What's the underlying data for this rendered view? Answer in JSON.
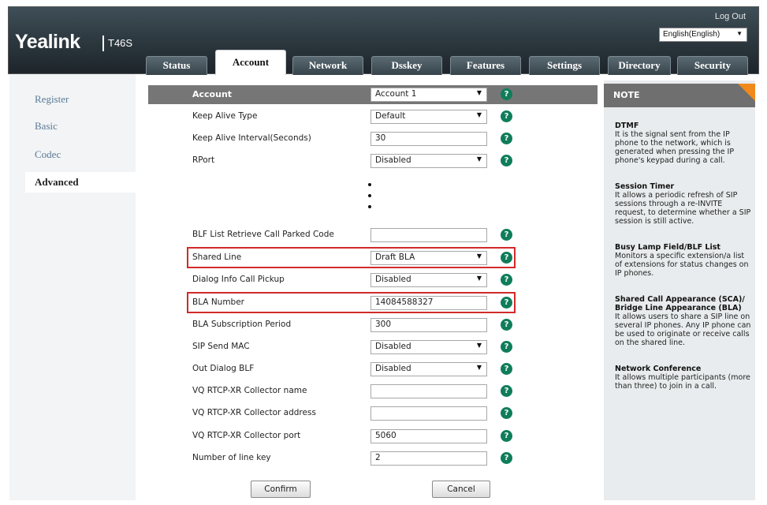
{
  "header": {
    "logo": "Yealink",
    "model": "T46S",
    "logout": "Log Out",
    "language": "English(English)"
  },
  "tabs": [
    "Status",
    "Account",
    "Network",
    "Dsskey",
    "Features",
    "Settings",
    "Directory",
    "Security"
  ],
  "active_tab": "Account",
  "sidebar": {
    "items": [
      "Register",
      "Basic",
      "Codec",
      "Advanced"
    ],
    "active": "Advanced"
  },
  "form": {
    "account_label": "Account",
    "account_value": "Account 1",
    "rows": [
      {
        "label": "Keep Alive Type",
        "value": "Default",
        "type": "select"
      },
      {
        "label": "Keep Alive Interval(Seconds)",
        "value": "30",
        "type": "text"
      },
      {
        "label": "RPort",
        "value": "Disabled",
        "type": "select"
      },
      {
        "label": "BLF List Retrieve Call Parked Code",
        "value": "",
        "type": "text"
      },
      {
        "label": "Shared Line",
        "value": "Draft BLA",
        "type": "select"
      },
      {
        "label": "Dialog Info Call Pickup",
        "value": "Disabled",
        "type": "select"
      },
      {
        "label": "BLA Number",
        "value": "14084588327",
        "type": "text"
      },
      {
        "label": "BLA Subscription Period",
        "value": "300",
        "type": "text"
      },
      {
        "label": "SIP Send MAC",
        "value": "Disabled",
        "type": "select"
      },
      {
        "label": "Out Dialog BLF",
        "value": "Disabled",
        "type": "select"
      },
      {
        "label": "VQ RTCP-XR Collector name",
        "value": "",
        "type": "text"
      },
      {
        "label": "VQ RTCP-XR Collector address",
        "value": "",
        "type": "text"
      },
      {
        "label": "VQ RTCP-XR Collector port",
        "value": "5060",
        "type": "text"
      },
      {
        "label": "Number of line key",
        "value": "2",
        "type": "text"
      }
    ],
    "confirm": "Confirm",
    "cancel": "Cancel"
  },
  "note": {
    "title": "NOTE",
    "sections": [
      {
        "title": "DTMF",
        "text": "It is the signal sent from the IP phone to the network, which is generated when pressing the IP phone's keypad during a call."
      },
      {
        "title": "Session Timer",
        "text": "It allows a periodic refresh of SIP sessions through a re-INVITE request, to determine whether a SIP session is still active."
      },
      {
        "title": "Busy Lamp Field/BLF List",
        "text": "Monitors a specific extension/a list of extensions for status changes on IP phones."
      },
      {
        "title": "Shared Call Appearance (SCA)/ Bridge Line Appearance (BLA)",
        "text": "It allows users to share a SIP line on several IP phones. Any IP phone can be used to originate or receive calls on the shared line."
      },
      {
        "title": "Network Conference",
        "text": "It allows multiple participants (more than three) to join in a call."
      }
    ]
  },
  "colors": {
    "help_icon": "#0f7d5a",
    "highlight": "#d12a2a",
    "note_corner": "#f08a1c"
  },
  "icons": [
    "help-icon",
    "dropdown-arrow-icon"
  ]
}
